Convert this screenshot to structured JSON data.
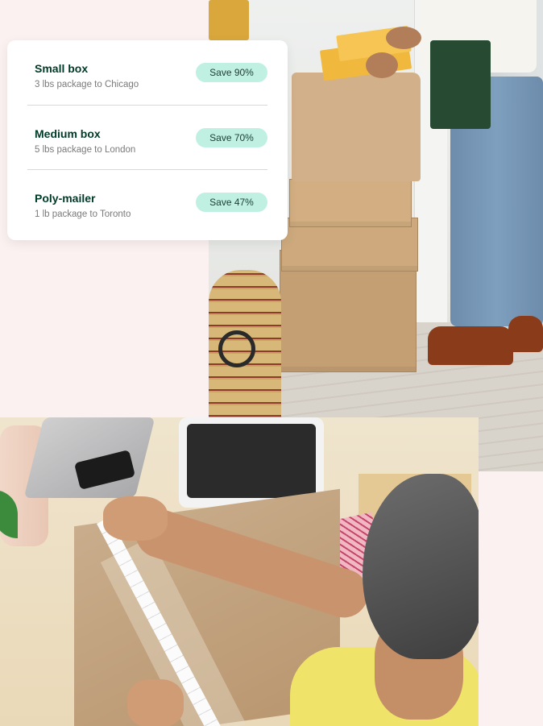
{
  "shipping_options": [
    {
      "name": "Small box",
      "details": "3 lbs package to Chicago",
      "savings": "Save 90%"
    },
    {
      "name": "Medium box",
      "details": "5 lbs package to London",
      "savings": "Save 70%"
    },
    {
      "name": "Poly-mailer",
      "details": "1 lb package to Toronto",
      "savings": "Save 47%"
    }
  ],
  "colors": {
    "page_background": "#fbf1f1",
    "card_background": "#ffffff",
    "title_text": "#003a28",
    "badge_background": "#bff0e2"
  }
}
